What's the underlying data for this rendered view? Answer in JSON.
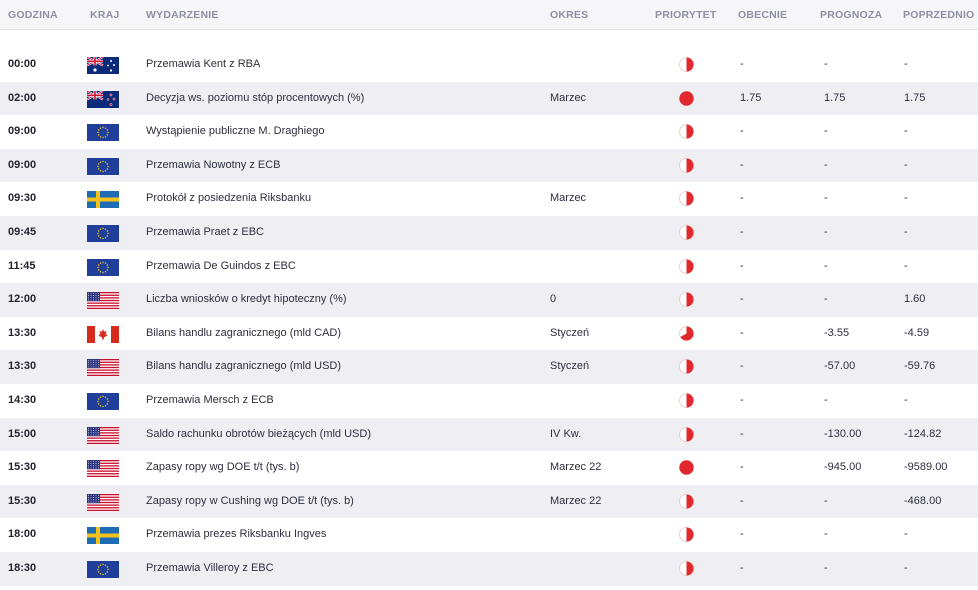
{
  "headers": {
    "time": "GODZINA",
    "country": "KRAJ",
    "event": "WYDARZENIE",
    "period": "OKRES",
    "priority": "PRIORYTET",
    "actual": "OBECNIE",
    "forecast": "PROGNOZA",
    "previous": "POPRZEDNIO"
  },
  "priority_colors": {
    "fill": "#e0282d",
    "empty": "#ffffff",
    "border": "#e8c6c8"
  },
  "events": [
    {
      "time": "00:00",
      "country": "AU",
      "event": "Przemawia Kent z RBA",
      "period": "",
      "priority": "low",
      "actual": "-",
      "forecast": "-",
      "previous": "-"
    },
    {
      "time": "02:00",
      "country": "NZ",
      "event": "Decyzja ws. poziomu stóp procentowych (%)",
      "period": "Marzec",
      "priority": "high",
      "actual": "1.75",
      "forecast": "1.75",
      "previous": "1.75"
    },
    {
      "time": "09:00",
      "country": "EU",
      "event": "Wystąpienie publiczne M. Draghiego",
      "period": "",
      "priority": "low",
      "actual": "-",
      "forecast": "-",
      "previous": "-"
    },
    {
      "time": "09:00",
      "country": "EU",
      "event": "Przemawia Nowotny z ECB",
      "period": "",
      "priority": "low",
      "actual": "-",
      "forecast": "-",
      "previous": "-"
    },
    {
      "time": "09:30",
      "country": "SE",
      "event": "Protokół z posiedzenia Riksbanku",
      "period": "Marzec",
      "priority": "low",
      "actual": "-",
      "forecast": "-",
      "previous": "-"
    },
    {
      "time": "09:45",
      "country": "EU",
      "event": "Przemawia Praet z EBC",
      "period": "",
      "priority": "low",
      "actual": "-",
      "forecast": "-",
      "previous": "-"
    },
    {
      "time": "11:45",
      "country": "EU",
      "event": "Przemawia De Guindos z EBC",
      "period": "",
      "priority": "low",
      "actual": "-",
      "forecast": "-",
      "previous": "-"
    },
    {
      "time": "12:00",
      "country": "US",
      "event": "Liczba wniosków o kredyt hipoteczny (%)",
      "period": "0",
      "priority": "low",
      "actual": "-",
      "forecast": "-",
      "previous": "1.60"
    },
    {
      "time": "13:30",
      "country": "CA",
      "event": "Bilans handlu zagranicznego (mld CAD)",
      "period": "Styczeń",
      "priority": "medium",
      "actual": "-",
      "forecast": "-3.55",
      "previous": "-4.59"
    },
    {
      "time": "13:30",
      "country": "US",
      "event": "Bilans handlu zagranicznego (mld USD)",
      "period": "Styczeń",
      "priority": "low",
      "actual": "-",
      "forecast": "-57.00",
      "previous": "-59.76"
    },
    {
      "time": "14:30",
      "country": "EU",
      "event": "Przemawia Mersch z ECB",
      "period": "",
      "priority": "low",
      "actual": "-",
      "forecast": "-",
      "previous": "-"
    },
    {
      "time": "15:00",
      "country": "US",
      "event": "Saldo rachunku obrotów bieżących (mld USD)",
      "period": "IV Kw.",
      "priority": "low",
      "actual": "-",
      "forecast": "-130.00",
      "previous": "-124.82"
    },
    {
      "time": "15:30",
      "country": "US",
      "event": "Zapasy ropy wg DOE t/t (tys. b)",
      "period": "Marzec 22",
      "priority": "high",
      "actual": "-",
      "forecast": "-945.00",
      "previous": "-9589.00"
    },
    {
      "time": "15:30",
      "country": "US",
      "event": "Zapasy ropy w Cushing wg DOE t/t (tys. b)",
      "period": "Marzec 22",
      "priority": "low",
      "actual": "-",
      "forecast": "-",
      "previous": "-468.00"
    },
    {
      "time": "18:00",
      "country": "SE",
      "event": "Przemawia prezes Riksbanku Ingves",
      "period": "",
      "priority": "low",
      "actual": "-",
      "forecast": "-",
      "previous": "-"
    },
    {
      "time": "18:30",
      "country": "EU",
      "event": "Przemawia Villeroy z EBC",
      "period": "",
      "priority": "low",
      "actual": "-",
      "forecast": "-",
      "previous": "-"
    }
  ]
}
